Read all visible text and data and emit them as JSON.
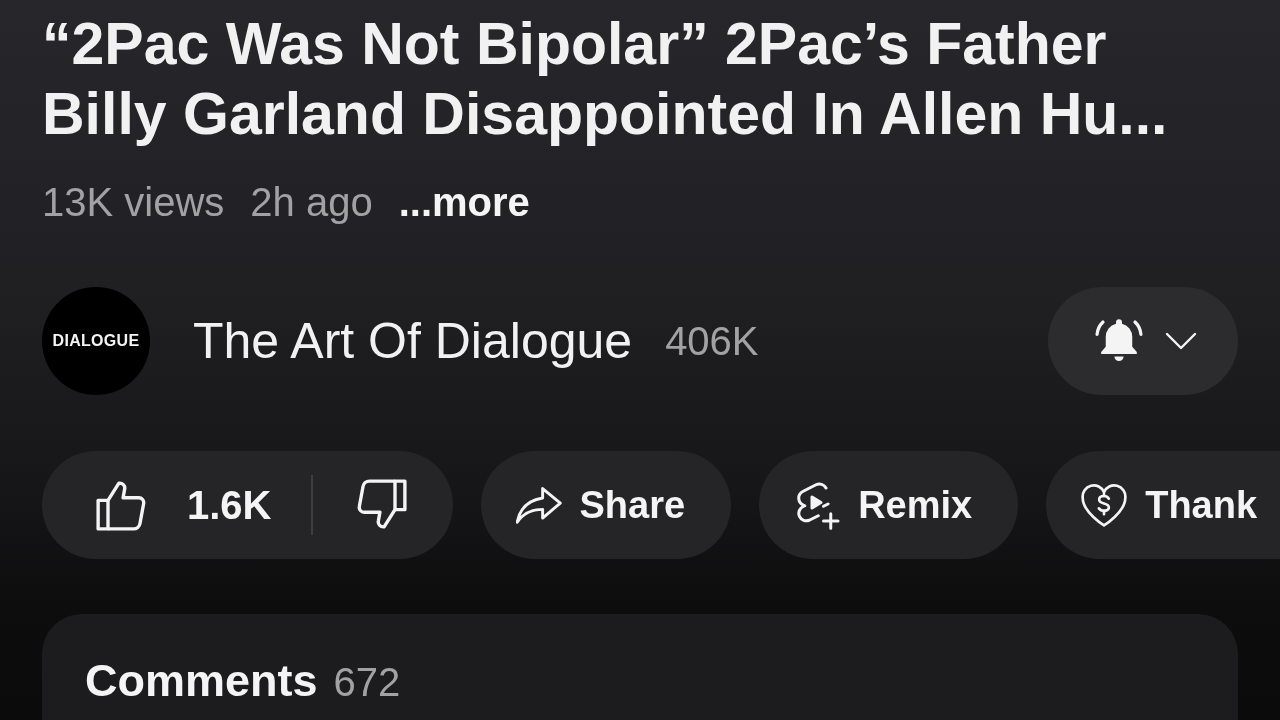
{
  "video": {
    "title": "“2Pac Was Not Bipolar” 2Pac’s Father Billy Garland Disappointed In Allen Hu...",
    "views": "13K views",
    "age": "2h ago",
    "more_link": "...more"
  },
  "channel": {
    "avatar_text": "DIALOGUE",
    "name": "The Art Of Dialogue",
    "subscribers": "406K",
    "all_notifications": true
  },
  "actions": [
    {
      "kind": "like_dislike",
      "count": "1.6K"
    },
    {
      "kind": "share",
      "label": "Share"
    },
    {
      "kind": "remix",
      "label": "Remix"
    },
    {
      "kind": "thanks",
      "label": "Thank"
    }
  ],
  "comments": {
    "title": "Comments",
    "count": "672"
  }
}
